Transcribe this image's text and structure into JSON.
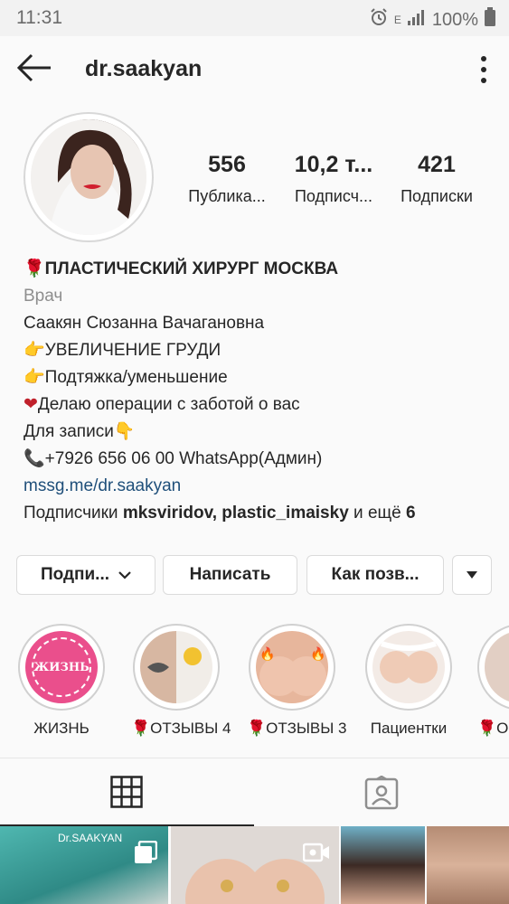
{
  "status_bar": {
    "time": "11:31",
    "battery": "100%",
    "network": "E"
  },
  "header": {
    "username": "dr.saakyan"
  },
  "stats": [
    {
      "value": "556",
      "label": "Публика..."
    },
    {
      "value": "10,2 т...",
      "label": "Подписч..."
    },
    {
      "value": "421",
      "label": "Подписки"
    }
  ],
  "bio": {
    "title": "ПЛАСТИЧЕСКИЙ ХИРУРГ МОСКВА",
    "category": "Врач",
    "lines": [
      "Саакян Сюзанна Вачагановна",
      "УВЕЛИЧЕНИЕ ГРУДИ",
      "Подтяжка/уменьшение",
      "Делаю операции с заботой о вас",
      "Для записи",
      "+7926 656 06 00 WhatsApp(Админ)"
    ],
    "link": "mssg.me/dr.saakyan",
    "followers_prefix": "Подписчики",
    "followers_names": "mksviridov, plastic_imaisky",
    "followers_suffix": "и ещё",
    "followers_more": "6"
  },
  "buttons": {
    "follow": "Подпи...",
    "message": "Написать",
    "contact": "Как позв..."
  },
  "highlights": [
    {
      "label": "ЖИЗНЬ",
      "image_text": "ЖИЗНЬ"
    },
    {
      "label": "ОТЗЫВЫ 4"
    },
    {
      "label": "ОТЗЫВЫ 3"
    },
    {
      "label": "Пациентки"
    },
    {
      "label": "О"
    }
  ],
  "thumb_text": "Dr.SAAKYAN",
  "colors": {
    "accent": "#262626",
    "link": "#1f4f7a",
    "rose": "#c0202b"
  }
}
